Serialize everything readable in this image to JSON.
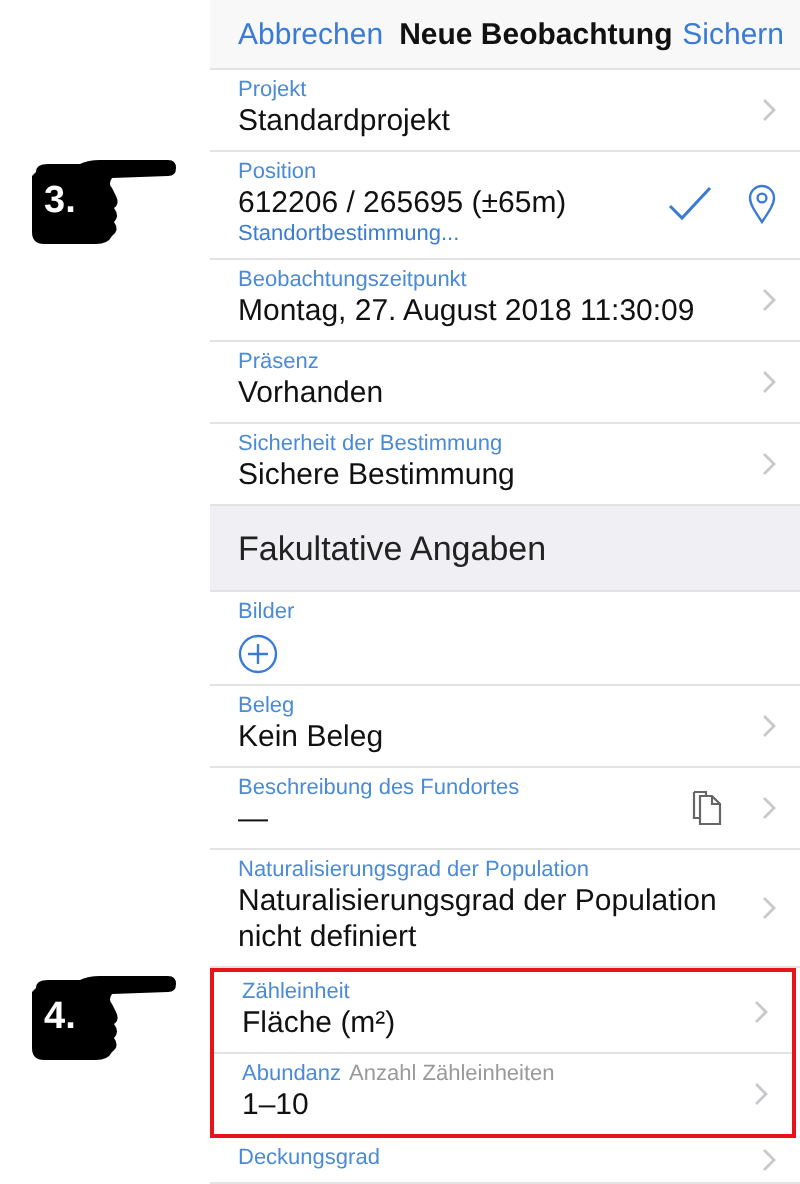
{
  "nav": {
    "cancel": "Abbrechen",
    "title": "Neue Beobachtung",
    "save": "Sichern"
  },
  "rows": [
    {
      "kind": "picker",
      "label": "Projekt",
      "value": "Standardprojekt",
      "highlighted": false
    },
    {
      "kind": "location",
      "label": "Position",
      "value": "612206 / 265695 (±65m)",
      "status": "Standortbestimmung...",
      "marker": "3.",
      "highlighted": false
    },
    {
      "kind": "picker",
      "label": "Beobachtungszeitpunkt",
      "value": "Montag, 27. August 2018 11:30:09",
      "highlighted": false
    },
    {
      "kind": "picker",
      "label": "Präsenz",
      "value": "Vorhanden",
      "highlighted": false
    },
    {
      "kind": "picker",
      "label": "Sicherheit der Bestimmung",
      "value": "Sichere Bestimmung",
      "highlighted": false
    },
    {
      "kind": "section",
      "title": "Fakultative Angaben",
      "highlighted": false
    },
    {
      "kind": "photos",
      "label": "Bilder",
      "highlighted": false
    },
    {
      "kind": "picker",
      "label": "Beleg",
      "value": "Kein Beleg",
      "highlighted": false
    },
    {
      "kind": "text",
      "label": "Beschreibung des Fundortes",
      "value": "—",
      "highlighted": false
    },
    {
      "kind": "picker",
      "label": "Naturalisierungsgrad der Population",
      "value": "Naturalisierungsgrad der Population nicht definiert",
      "highlighted": false
    },
    {
      "kind": "picker",
      "label": "Zähleinheit",
      "value": "Fläche (m²)",
      "marker": "4.",
      "highlighted": true
    },
    {
      "kind": "picker",
      "label": "Abundanz",
      "hint": "Anzahl Zähleinheiten",
      "value": "1–10",
      "highlighted": true
    },
    {
      "kind": "picker",
      "label": "Deckungsgrad",
      "highlighted": false
    }
  ]
}
